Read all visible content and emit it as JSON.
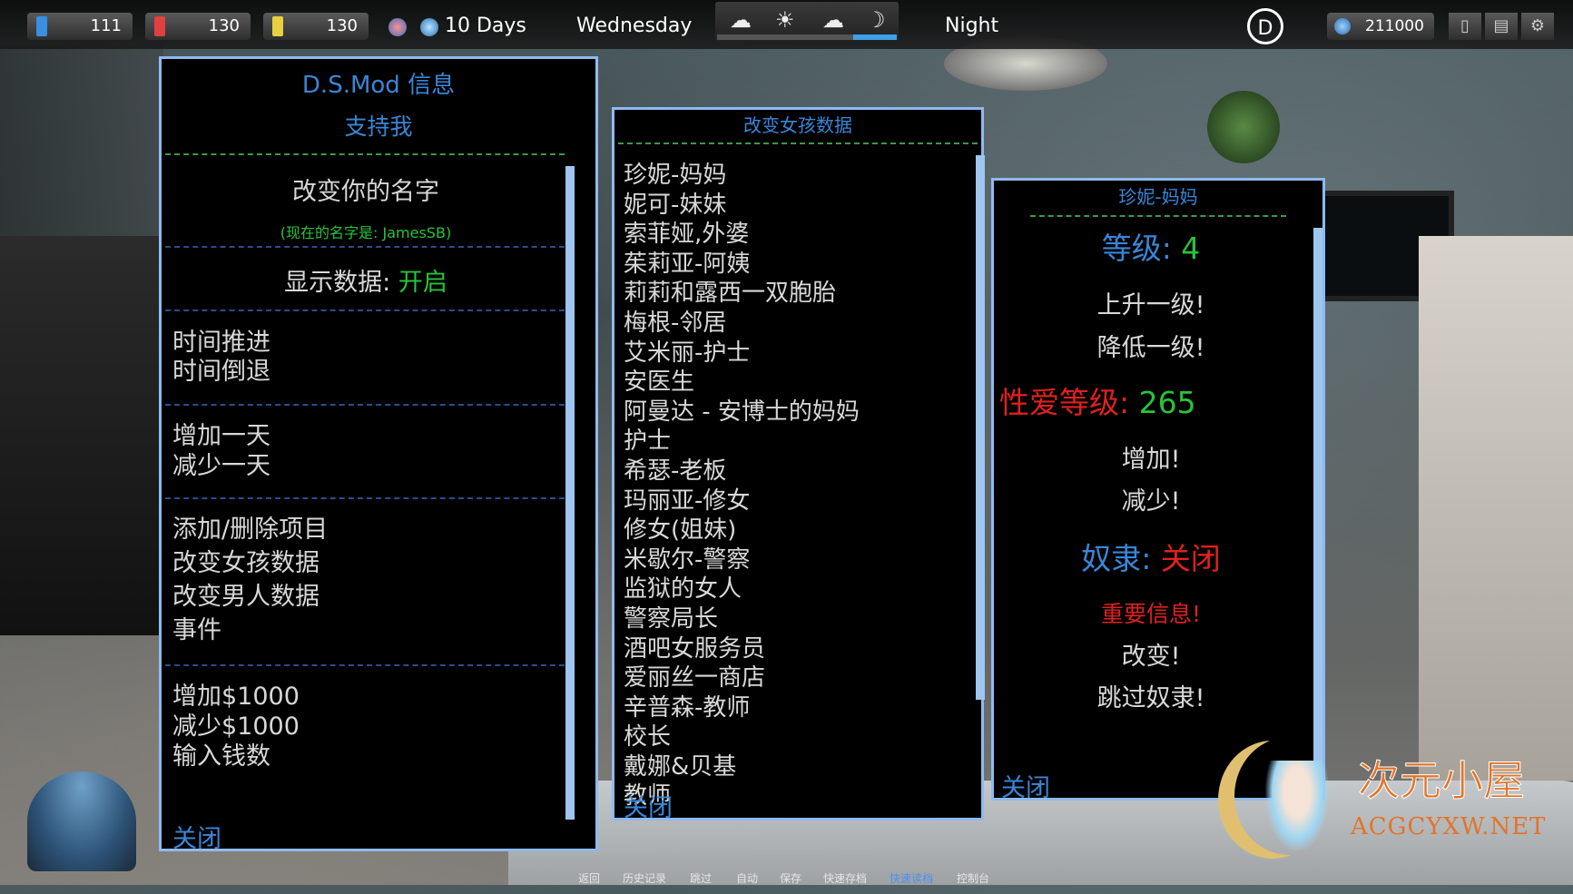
{
  "hud": {
    "stat1": "111",
    "stat2": "130",
    "stat3": "130",
    "days": "10 Days",
    "weekday": "Wednesday",
    "weather_icons": [
      "sunrise-icon",
      "sun-icon",
      "sunset-icon",
      "moon-icon"
    ],
    "period": "Night",
    "money": "211000",
    "colors": {
      "stat1": "#3a8fe0",
      "stat2": "#e04040",
      "stat3": "#e8d040",
      "accent": "#3fa0e8"
    }
  },
  "mod_panel": {
    "title": "D.S.Mod 信息",
    "subtitle": "支持我",
    "change_name": "改变你的名字",
    "current_name": "(现在的名字是: JamesSB)",
    "show_data_label": "显示数据: ",
    "show_data_value": "开启",
    "time_forward": "时间推进",
    "time_back": "时间倒退",
    "add_day": "增加一天",
    "sub_day": "减少一天",
    "items": "添加/删除项目",
    "girls": "改变女孩数据",
    "men": "改变男人数据",
    "events": "事件",
    "add_money": "增加$1000",
    "sub_money": "减少$1000",
    "enter_money": "输入钱数",
    "close": "关闭"
  },
  "girls_panel": {
    "title": "改变女孩数据",
    "entries": [
      "珍妮-妈妈",
      "妮可-妹妹",
      "索菲娅,外婆",
      "茱莉亚-阿姨",
      "莉莉和露西一双胞胎",
      "梅根-邻居",
      "艾米丽-护士",
      "安医生",
      "阿曼达 - 安博士的妈妈",
      "护士",
      "希瑟-老板",
      "玛丽亚-修女",
      "修女(姐妹)",
      "米歇尔-警察",
      "监狱的女人",
      "警察局长",
      "酒吧女服务员",
      "爱丽丝一商店",
      "辛普森-教师",
      "校长",
      "戴娜&贝基",
      "教师"
    ],
    "close": "关闭"
  },
  "char_panel": {
    "title": "珍妮-妈妈",
    "level_label": "等级: ",
    "level_value": "4",
    "level_up": "上升一级!",
    "level_down": "降低一级!",
    "sex_label": "性爱等级: ",
    "sex_value": "265",
    "increase": "增加!",
    "decrease": "减少!",
    "slave_label": "奴隶: ",
    "slave_value": "关闭",
    "important": "重要信息!",
    "change": "改变!",
    "skip_slave": "跳过奴隶!",
    "close": "关闭"
  },
  "watermark": {
    "name": "次元小屋",
    "site": "ACGCYXW.NET"
  },
  "bottom_menu": [
    "返回",
    "历史记录",
    "跳过",
    "自动",
    "保存",
    "快速存档",
    "快速读档",
    "控制台"
  ]
}
